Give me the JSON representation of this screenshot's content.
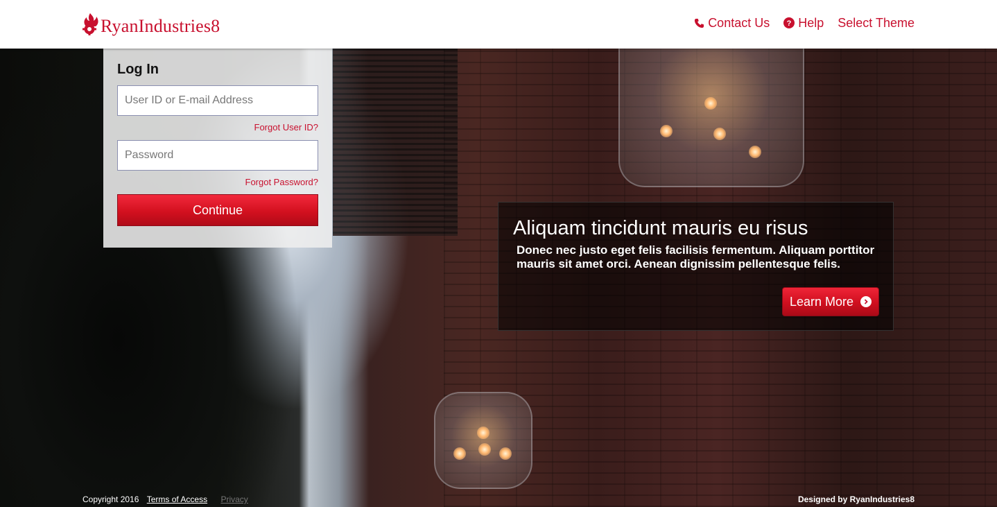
{
  "header": {
    "brand": "RyanIndustries8",
    "nav": {
      "contact_label": "Contact Us",
      "help_label": "Help",
      "theme_label": "Select Theme"
    }
  },
  "login": {
    "title": "Log In",
    "user_placeholder": "User ID or E-mail Address",
    "forgot_user_label": "Forgot User ID?",
    "password_placeholder": "Password",
    "forgot_password_label": "Forgot Password?",
    "continue_label": "Continue"
  },
  "promo": {
    "title": "Aliquam tincidunt mauris eu risus",
    "body": "Donec nec justo eget felis facilisis fermentum. Aliquam porttitor mauris sit amet orci. Aenean dignissim pellentesque felis.",
    "button_label": "Learn More"
  },
  "footer": {
    "copyright": "Copyright 2016",
    "terms_label": "Terms of Access",
    "privacy_label": "Privacy",
    "designed_by": "Designed by RyanIndustries8"
  },
  "colors": {
    "brand_red": "#c8102e",
    "button_red": "#d3101f"
  },
  "icons": [
    "flame-gear-logo-icon",
    "phone-icon",
    "question-circle-icon",
    "chevron-right-circle-icon"
  ]
}
